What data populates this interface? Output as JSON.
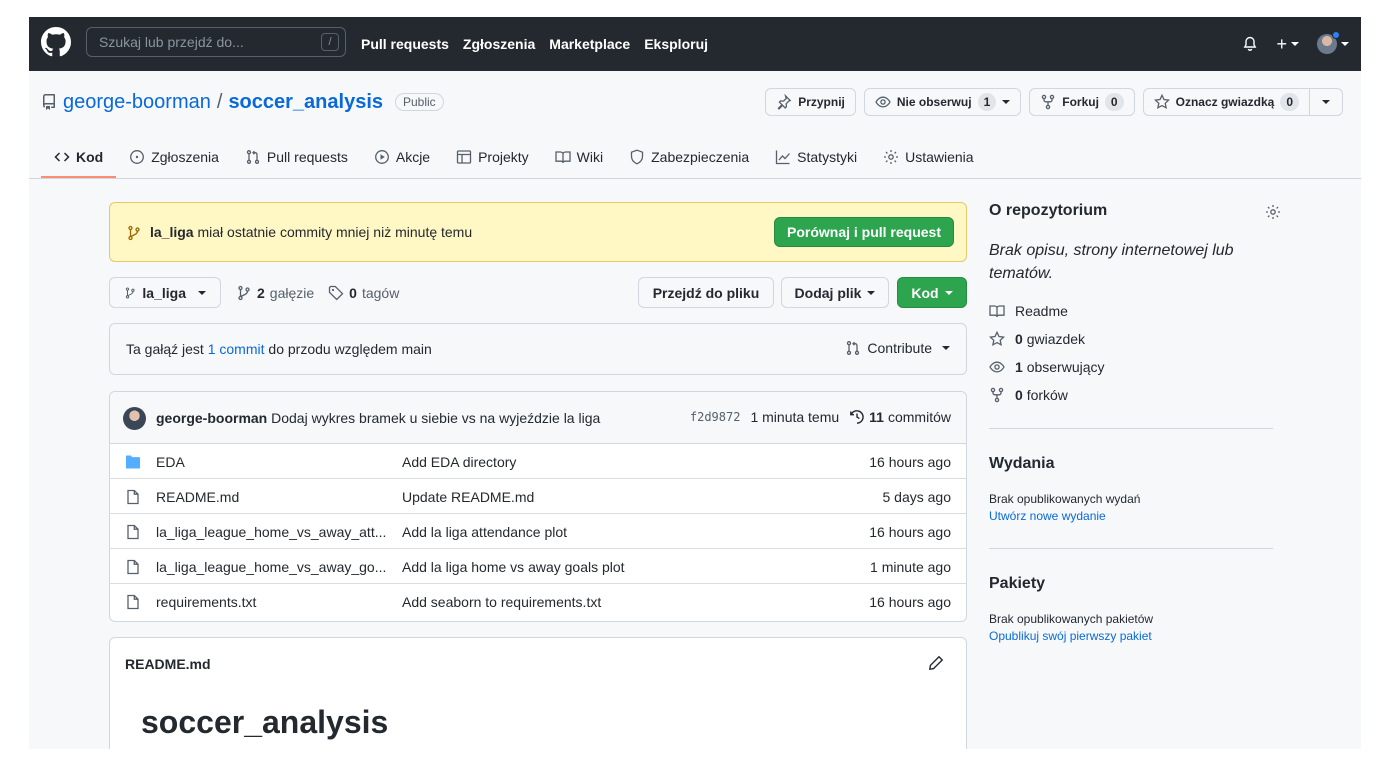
{
  "header": {
    "search_placeholder": "Szukaj lub przejdź do...",
    "search_shortcut": "/",
    "nav": [
      "Pull requests",
      "Zgłoszenia",
      "Marketplace",
      "Eksploruj"
    ],
    "plus_label": "+"
  },
  "repo": {
    "owner": "george-boorman",
    "separator": "/",
    "name": "soccer_analysis",
    "visibility": "Public",
    "actions": {
      "pin": "Przypnij",
      "watch": "Nie obserwuj",
      "watch_count": "1",
      "fork": "Forkuj",
      "fork_count": "0",
      "star": "Oznacz gwiazdką",
      "star_count": "0"
    }
  },
  "tabs": [
    {
      "label": "Kod",
      "icon": "code-icon"
    },
    {
      "label": "Zgłoszenia",
      "icon": "issue-icon"
    },
    {
      "label": "Pull requests",
      "icon": "pull-request-icon"
    },
    {
      "label": "Akcje",
      "icon": "play-icon"
    },
    {
      "label": "Projekty",
      "icon": "table-icon"
    },
    {
      "label": "Wiki",
      "icon": "book-icon"
    },
    {
      "label": "Zabezpieczenia",
      "icon": "shield-icon"
    },
    {
      "label": "Statystyki",
      "icon": "graph-icon"
    },
    {
      "label": "Ustawienia",
      "icon": "gear-icon"
    }
  ],
  "flash": {
    "branch": "la_liga",
    "text": " miał ostatnie commity mniej niż minutę temu",
    "button": "Porównaj i pull request"
  },
  "branch_bar": {
    "current_branch": "la_liga",
    "branches_count": "2",
    "branches_label": "gałęzie",
    "tags_count": "0",
    "tags_label": "tagów",
    "goto_file": "Przejdź do pliku",
    "add_file": "Dodaj plik",
    "code": "Kod"
  },
  "ahead": {
    "prefix": "Ta gałąź jest ",
    "link": "1 commit",
    "suffix": " do przodu względem main",
    "contribute": "Contribute"
  },
  "latest_commit": {
    "author": "george-boorman",
    "message": "Dodaj wykres bramek u siebie vs na wyjeździe la liga",
    "sha": "f2d9872",
    "time": "1 minuta temu",
    "count": "11",
    "count_label": "commitów"
  },
  "files": [
    {
      "type": "folder",
      "name": "EDA",
      "message": "Add EDA directory",
      "time": "16 hours ago"
    },
    {
      "type": "file",
      "name": "README.md",
      "message": "Update README.md",
      "time": "5 days ago"
    },
    {
      "type": "file",
      "name": "la_liga_league_home_vs_away_att...",
      "message": "Add la liga attendance plot",
      "time": "16 hours ago"
    },
    {
      "type": "file",
      "name": "la_liga_league_home_vs_away_go...",
      "message": "Add la liga home vs away goals plot",
      "time": "1 minute ago"
    },
    {
      "type": "file",
      "name": "requirements.txt",
      "message": "Add seaborn to requirements.txt",
      "time": "16 hours ago"
    }
  ],
  "readme": {
    "filename": "README.md",
    "heading": "soccer_analysis"
  },
  "sidebar": {
    "about_title": "O repozytorium",
    "about_desc": "Brak opisu, strony internetowej lub tematów.",
    "readme": "Readme",
    "stars_count": "0",
    "stars_label": "gwiazdek",
    "watchers_count": "1",
    "watchers_label": "obserwujący",
    "forks_count": "0",
    "forks_label": "forków",
    "releases_title": "Wydania",
    "releases_empty": "Brak opublikowanych wydań",
    "releases_link": "Utwórz nowe wydanie",
    "packages_title": "Pakiety",
    "packages_empty": "Brak opublikowanych pakietów",
    "packages_link": "Opublikuj swój pierwszy pakiet"
  },
  "colors": {
    "header_bg": "#24292f",
    "accent_green": "#2da44e",
    "link_blue": "#0969da",
    "flash_bg": "#fff8c5",
    "tab_underline": "#fd8c73"
  }
}
